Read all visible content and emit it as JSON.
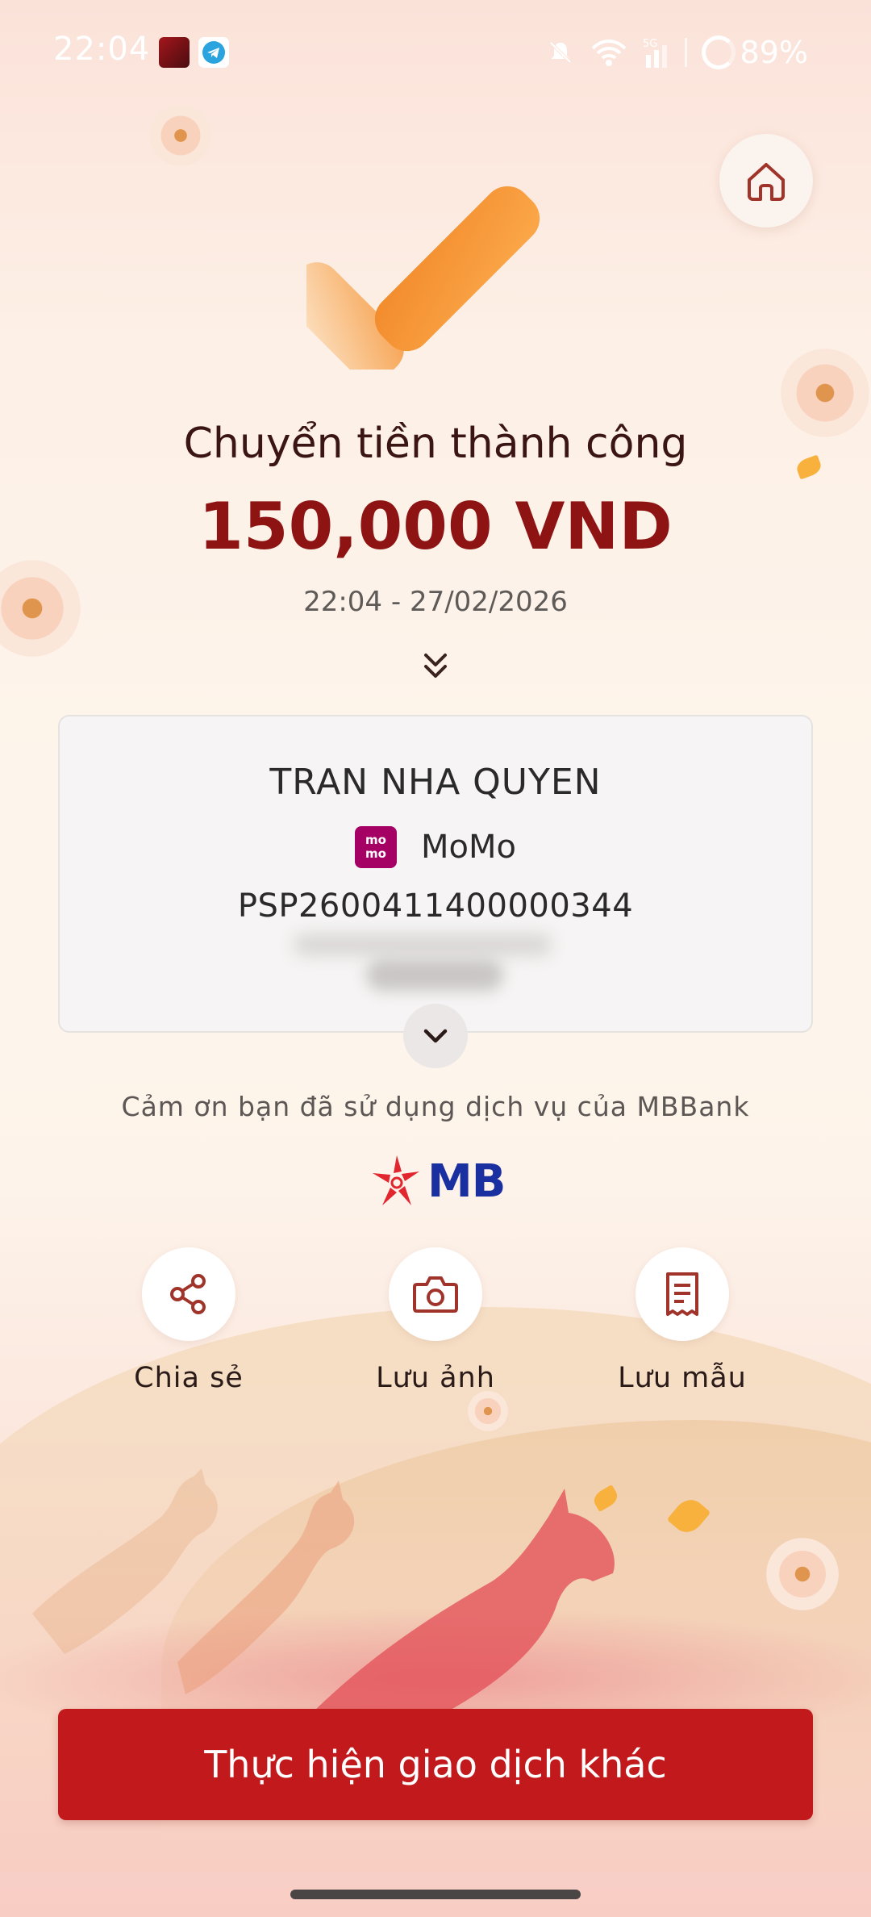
{
  "status_bar": {
    "time": "22:04",
    "battery": "89%",
    "icons": [
      "app-icon",
      "telegram-icon",
      "bell-off-icon",
      "wifi-icon",
      "signal-5g-icon",
      "battery-icon"
    ]
  },
  "header": {
    "home_icon": "home-icon"
  },
  "result": {
    "title": "Chuyển tiền thành công",
    "amount": "150,000 VND",
    "datetime": "22:04 - 27/02/2026"
  },
  "recipient": {
    "name": "TRAN NHA QUYEN",
    "bank_logo_text": [
      "mo",
      "mo"
    ],
    "bank": "MoMo",
    "account": "PSP2600411400000344"
  },
  "footer": {
    "thanks": "Cảm ơn bạn đã sử dụng dịch vụ của MBBank",
    "logo_text": "MB"
  },
  "actions": [
    {
      "label": "Chia sẻ",
      "icon": "share-icon"
    },
    {
      "label": "Lưu ảnh",
      "icon": "camera-icon"
    },
    {
      "label": "Lưu mẫu",
      "icon": "receipt-icon"
    }
  ],
  "primary_button": {
    "label": "Thực hiện giao dịch khác"
  },
  "colors": {
    "brand_red": "#c1191c",
    "amount_red": "#8e1414",
    "mb_blue": "#1a2fa0",
    "momo_purple": "#a50064"
  }
}
